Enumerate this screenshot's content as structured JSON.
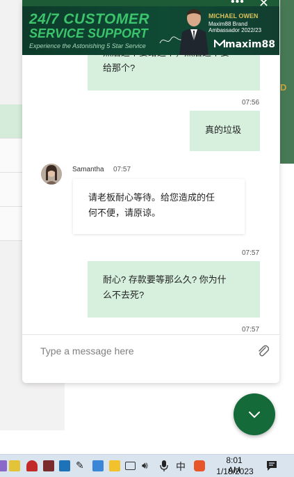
{
  "banner": {
    "headline_1": "24/7 CUSTOMER",
    "headline_2": "SERVICE SUPPORT",
    "tagline": "Experience the Astonishing 5 Star Service",
    "ambassador_name": "MICHAEL OWEN",
    "ambassador_role_1": "Maxim88 Brand",
    "ambassador_role_2": "Ambassador 2022/23",
    "logo_text": "maxim88",
    "menu_icon": "more-dots-icon",
    "close_icon": "close-icon"
  },
  "background": {
    "right_strip_letter": "D"
  },
  "messages": [
    {
      "direction": "out",
      "text_line_1": "然后这个要给这个，然后这个要",
      "text_line_2": "给那个?",
      "time": "07:56"
    },
    {
      "direction": "out",
      "text_line_1": "真的垃圾",
      "time": ""
    },
    {
      "direction": "in",
      "sender": "Samantha",
      "sender_time": "07:57",
      "text_line_1": "请老板耐心等待。给您造成的任",
      "text_line_2": "何不便，请原谅。",
      "time": "07:57"
    },
    {
      "direction": "out",
      "text_line_1": "耐心? 存款要等那么久? 你为什",
      "text_line_2": "么不去死?",
      "time": "07:57"
    }
  ],
  "composer": {
    "placeholder": "Type a message here",
    "attach_icon": "paperclip-icon"
  },
  "fab": {
    "icon": "chevron-down-icon"
  },
  "taskbar": {
    "ime_label": "中",
    "time": "8:01 AM",
    "date": "1/18/2023",
    "notification_icon": "notification-icon"
  },
  "colors": {
    "outgoing_bubble": "#d6f0dd",
    "fab_green": "#156a39",
    "banner_green": "#3cc46c"
  }
}
